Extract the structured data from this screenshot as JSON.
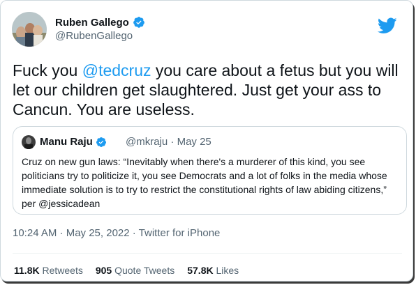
{
  "author": {
    "name": "Ruben Gallego",
    "handle": "@RubenGallego",
    "verified_icon": "verified-badge-icon"
  },
  "tweet": {
    "text_before": "Fuck you ",
    "mention": "@tedcruz",
    "text_after": " you care about a fetus but you will let our children get slaughtered.  Just get your ass to Cancun. You are useless."
  },
  "quote": {
    "name": "Manu Raju",
    "handle": "@mkraju",
    "separator": "·",
    "date": "May 25",
    "text": "Cruz on new gun laws: “Inevitably when there's a murderer of this kind, you see politicians try to politicize it, you see Democrats and a lot of folks in the media whose immediate solution is to try to restrict the constitutional rights of law abiding citizens,” per @jessicadean"
  },
  "timestamp": "10:24 AM · May 25, 2022 · Twitter for iPhone",
  "stats": {
    "retweets_count": "11.8K",
    "retweets_label": "Retweets",
    "quotes_count": "905",
    "quotes_label": "Quote Tweets",
    "likes_count": "57.8K",
    "likes_label": "Likes"
  },
  "colors": {
    "accent": "#1d9bf0",
    "text": "#0f1419",
    "muted": "#536471",
    "border": "#cfd9de"
  }
}
